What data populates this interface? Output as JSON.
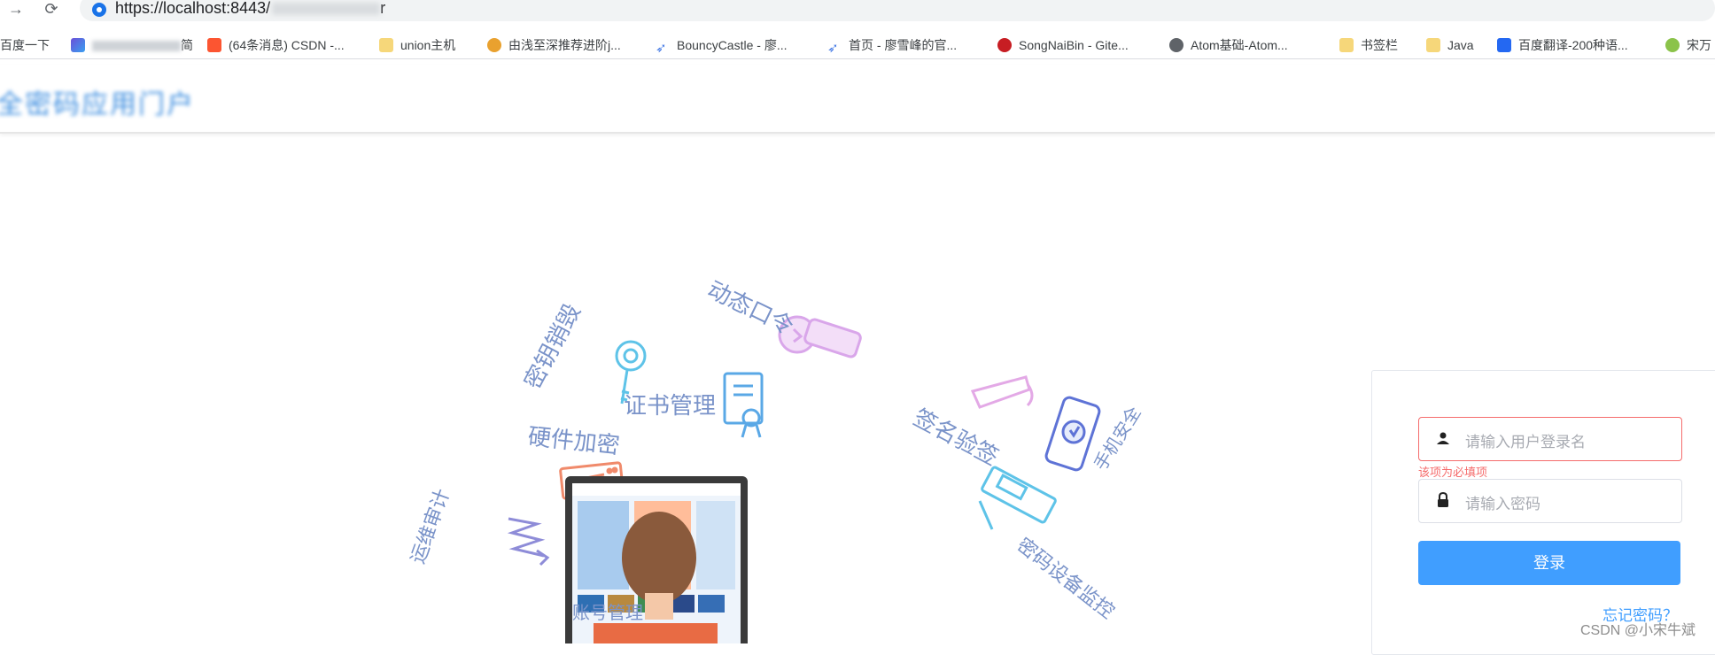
{
  "browser": {
    "url_visible": "https://localhost:8443/",
    "url_tail": "r",
    "bookmarks": [
      {
        "label": "百度一下",
        "icon": "baidu-icon"
      },
      {
        "label": "简",
        "icon": "hexagon-icon",
        "blurred_prefix": true
      },
      {
        "label": "(64条消息) CSDN -...",
        "icon": "csdn-icon",
        "color": "#fc5531"
      },
      {
        "label": "union主机",
        "icon": "folder-icon"
      },
      {
        "label": "由浅至深推荐进阶j...",
        "icon": "bee-icon"
      },
      {
        "label": "BouncyCastle - 廖...",
        "icon": "rocket-icon"
      },
      {
        "label": "首页 - 廖雪峰的官...",
        "icon": "rocket-icon"
      },
      {
        "label": "SongNaiBin - Gite...",
        "icon": "gitee-icon",
        "color": "#c71d23"
      },
      {
        "label": "Atom基础-Atom...",
        "icon": "globe-icon"
      },
      {
        "label": "书签栏",
        "icon": "folder-icon"
      },
      {
        "label": "Java",
        "icon": "folder-icon"
      },
      {
        "label": "百度翻译-200种语...",
        "icon": "translate-icon",
        "color": "#2468f2"
      },
      {
        "label": "宋万",
        "icon": "panda-icon"
      }
    ]
  },
  "header": {
    "title": "全密码应用门户"
  },
  "features": {
    "f1": "动态口令",
    "f2": "证书管理",
    "f3": "密钥销毁",
    "f4": "签名验签",
    "f5": "手机安全",
    "f6": "硬件加密",
    "f7": "运维审计",
    "f8": "账号管理",
    "f9": "密码设备监控"
  },
  "login": {
    "username_placeholder": "请输入用户登录名",
    "username_error": "该项为必填项",
    "password_placeholder": "请输入密码",
    "submit_label": "登录",
    "forgot_label": "忘记密码？"
  },
  "watermark": "CSDN @小宋牛斌",
  "colors": {
    "accent": "#409eff",
    "error": "#f56c6c",
    "feature_text": "#7a93c9"
  }
}
